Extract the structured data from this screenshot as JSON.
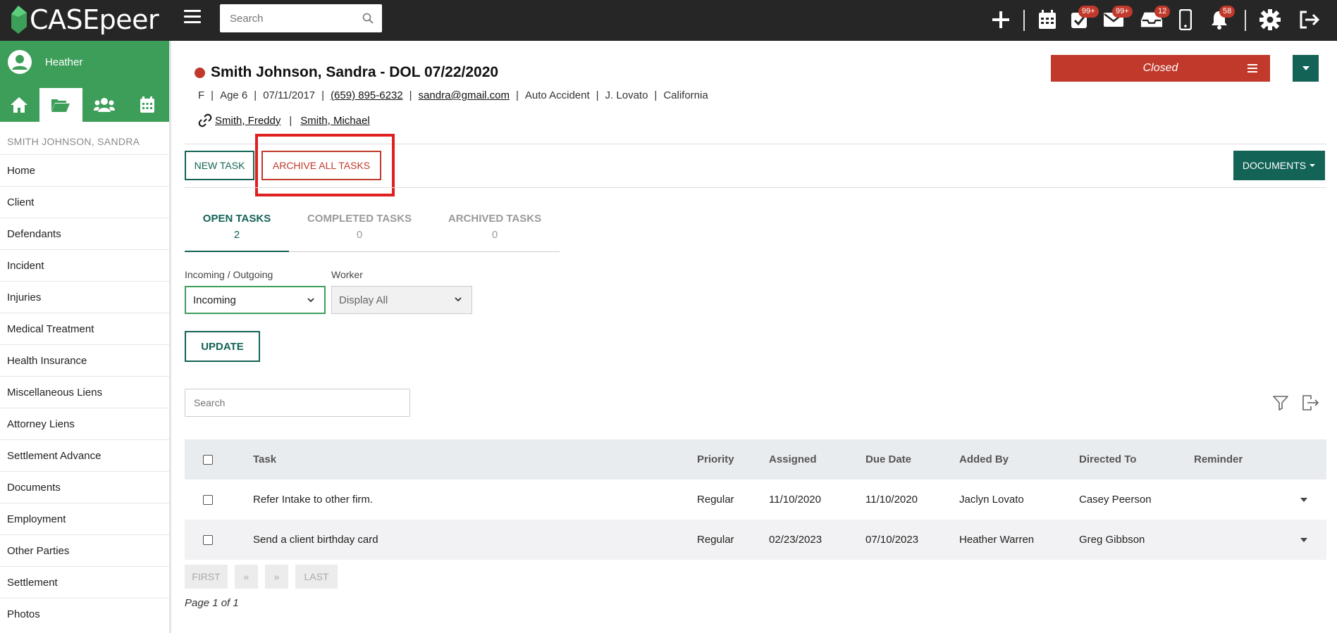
{
  "brand": {
    "name": "CASEpeer"
  },
  "topbar": {
    "search_placeholder": "Search",
    "badges": {
      "tasks": "99+",
      "mail": "99+",
      "inbox": "12",
      "notifications": "58"
    }
  },
  "sidebar": {
    "user_name": "Heather",
    "case_label": "SMITH JOHNSON, SANDRA",
    "items": [
      "Home",
      "Client",
      "Defendants",
      "Incident",
      "Injuries",
      "Medical Treatment",
      "Health Insurance",
      "Miscellaneous Liens",
      "Attorney Liens",
      "Settlement Advance",
      "Documents",
      "Employment",
      "Other Parties",
      "Settlement",
      "Photos"
    ]
  },
  "case": {
    "title": "Smith Johnson, Sandra - DOL 07/22/2020",
    "gender": "F",
    "age": "Age 6",
    "dob": "07/11/2017",
    "phone": "(659) 895-6232",
    "email": "sandra@gmail.com",
    "case_type": "Auto Accident",
    "attorney": "J. Lovato",
    "state": "California",
    "related": [
      "Smith, Freddy",
      "Smith, Michael"
    ],
    "status": "Closed"
  },
  "actions": {
    "new_task": "NEW TASK",
    "archive_all": "ARCHIVE ALL TASKS",
    "documents": "DOCUMENTS"
  },
  "tabs": [
    {
      "label": "OPEN TASKS",
      "count": "2"
    },
    {
      "label": "COMPLETED TASKS",
      "count": "0"
    },
    {
      "label": "ARCHIVED TASKS",
      "count": "0"
    }
  ],
  "filters": {
    "direction_label": "Incoming / Outgoing",
    "direction_value": "Incoming",
    "worker_label": "Worker",
    "worker_value": "Display All",
    "update": "UPDATE",
    "search_placeholder": "Search"
  },
  "table": {
    "headers": [
      "Task",
      "Priority",
      "Assigned",
      "Due Date",
      "Added By",
      "Directed To",
      "Reminder"
    ],
    "rows": [
      [
        "Refer Intake to other firm.",
        "Regular",
        "11/10/2020",
        "11/10/2020",
        "Jaclyn Lovato",
        "Casey Peerson",
        ""
      ],
      [
        "Send a client birthday card",
        "Regular",
        "02/23/2023",
        "07/10/2023",
        "Heather Warren",
        "Greg Gibbson",
        ""
      ]
    ]
  },
  "pager": {
    "first": "FIRST",
    "prev": "«",
    "next": "»",
    "last": "LAST",
    "info": "Page 1 of 1"
  },
  "colors": {
    "brand_green": "#3d9e59",
    "dark_teal": "#136356",
    "status_red": "#c0392b",
    "topbar": "#262626"
  }
}
